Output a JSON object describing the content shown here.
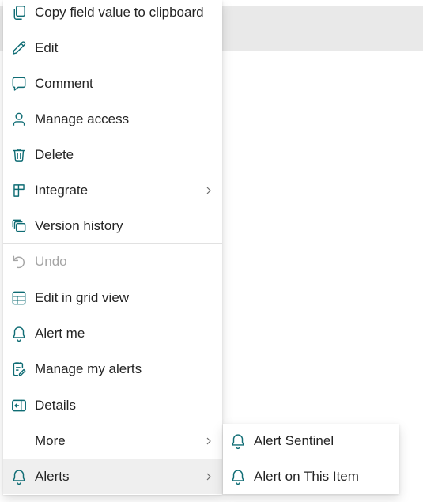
{
  "colors": {
    "icon_teal": "#0f6c74",
    "icon_disabled": "#a6a6a6",
    "text": "#242424",
    "text_disabled": "#a6a6a6",
    "selected_bg": "#efefef"
  },
  "menu": {
    "items": [
      {
        "label": "Copy field value to clipboard",
        "icon": "copy-icon"
      },
      {
        "label": "Edit",
        "icon": "pencil-icon"
      },
      {
        "label": "Comment",
        "icon": "comment-icon"
      },
      {
        "label": "Manage access",
        "icon": "person-icon"
      },
      {
        "label": "Delete",
        "icon": "trash-icon"
      },
      {
        "label": "Integrate",
        "icon": "integrate-icon",
        "has_submenu": true
      },
      {
        "label": "Version history",
        "icon": "version-history-icon"
      },
      {
        "label": "Undo",
        "icon": "undo-icon",
        "disabled": true
      },
      {
        "label": "Edit in grid view",
        "icon": "grid-icon"
      },
      {
        "label": "Alert me",
        "icon": "bell-icon"
      },
      {
        "label": "Manage my alerts",
        "icon": "manage-alerts-icon"
      },
      {
        "label": "Details",
        "icon": "details-icon"
      },
      {
        "label": "More",
        "has_submenu": true
      },
      {
        "label": "Alerts",
        "icon": "bell-icon",
        "has_submenu": true,
        "selected": true
      }
    ]
  },
  "submenu": {
    "items": [
      {
        "label": "Alert Sentinel",
        "icon": "bell-icon"
      },
      {
        "label": "Alert on This Item",
        "icon": "bell-icon"
      }
    ]
  }
}
